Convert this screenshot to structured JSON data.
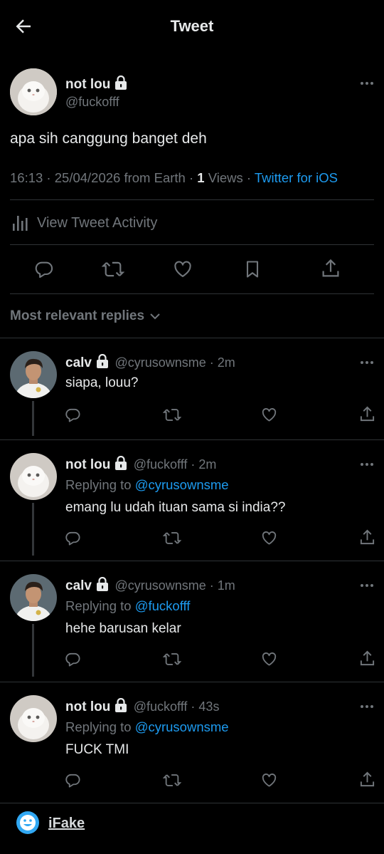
{
  "header": {
    "title": "Tweet"
  },
  "tweet": {
    "name": "not lou",
    "handle": "@fuckofff",
    "text": "apa sih canggung banget deh",
    "time": "16:13 · 25/04/2026 from Earth · ",
    "views_count": "1",
    "views_label": " Views · ",
    "client": "Twitter for iOS",
    "activity_label": "View Tweet Activity"
  },
  "replies_sort": {
    "label": "Most relevant replies"
  },
  "replies": [
    {
      "name": "calv",
      "handle": "@cyrusownsme",
      "age": " · 2m",
      "replying_prefix": "",
      "replying_to": "",
      "text": "siapa, louu?"
    },
    {
      "name": "not lou",
      "handle": "@fuckofff",
      "age": " · 2m",
      "replying_prefix": "Replying to ",
      "replying_to": "@cyrusownsme",
      "text": "emang lu udah ituan sama si india??"
    },
    {
      "name": "calv",
      "handle": "@cyrusownsme",
      "age": " · 1m",
      "replying_prefix": "Replying to ",
      "replying_to": "@fuckofff",
      "text": "hehe barusan kelar"
    },
    {
      "name": "not lou",
      "handle": "@fuckofff",
      "age": " · 43s",
      "replying_prefix": "Replying to ",
      "replying_to": "@cyrusownsme",
      "text": "FUCK TMI"
    }
  ],
  "footer": {
    "brand": "iFake"
  },
  "colors": {
    "accent": "#1d9bf0",
    "muted": "#71767b",
    "text": "#e7e9ea",
    "divider": "#2f3336"
  }
}
